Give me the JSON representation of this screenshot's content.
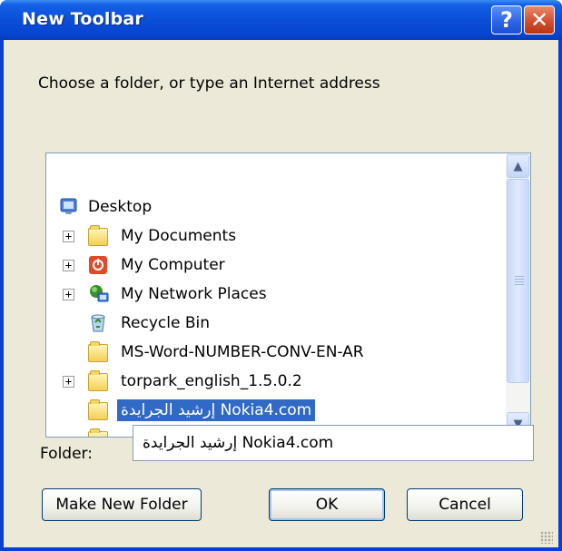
{
  "window": {
    "title": "New Toolbar",
    "help_glyph": "?",
    "close_glyph": "✕"
  },
  "prompt": "Choose a folder, or type an Internet address",
  "tree": {
    "items": [
      {
        "label": "Desktop",
        "icon": "desktop-icon",
        "expander": ""
      },
      {
        "label": "My Documents",
        "icon": "folder-icon",
        "expander": "+"
      },
      {
        "label": "My Computer",
        "icon": "computer-icon",
        "expander": "+"
      },
      {
        "label": "My Network Places",
        "icon": "network-places-icon",
        "expander": "+"
      },
      {
        "label": "Recycle Bin",
        "icon": "recycle-bin-icon",
        "expander": ""
      },
      {
        "label": "MS-Word-NUMBER-CONV-EN-AR",
        "icon": "folder-icon",
        "expander": ""
      },
      {
        "label": "torpark_english_1.5.0.2",
        "icon": "folder-icon",
        "expander": "+"
      },
      {
        "label": "إرشيد الجرايدة Nokia4.com",
        "icon": "folder-icon",
        "expander": "",
        "selected": true
      }
    ]
  },
  "folder": {
    "label": "Folder:",
    "value": "إرشيد الجرايدة Nokia4.com"
  },
  "buttons": {
    "make_new_folder": "Make New Folder",
    "ok": "OK",
    "cancel": "Cancel"
  },
  "colors": {
    "title_bar": "#0a4ed8",
    "selection": "#316ac5",
    "dialog_face": "#ece9d8"
  }
}
